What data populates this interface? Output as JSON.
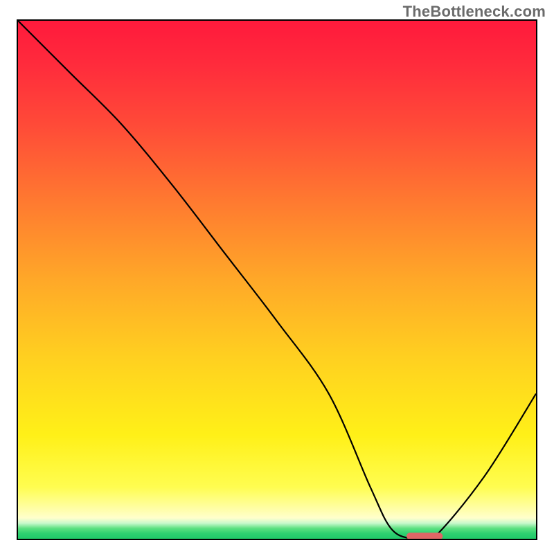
{
  "watermark": "TheBottleneck.com",
  "chart_data": {
    "type": "line",
    "title": "",
    "xlabel": "",
    "ylabel": "",
    "xlim": [
      0,
      100
    ],
    "ylim": [
      0,
      100
    ],
    "grid": false,
    "legend": false,
    "series": [
      {
        "name": "bottleneck-curve",
        "x": [
          0,
          10,
          20,
          30,
          40,
          50,
          60,
          68,
          72,
          76,
          80,
          90,
          100
        ],
        "y": [
          100,
          90,
          80,
          68,
          55,
          42,
          28,
          10,
          2,
          0,
          0,
          12,
          28
        ]
      }
    ],
    "annotations": [
      {
        "name": "optimal-marker",
        "x_range": [
          75,
          82
        ],
        "y": 0.5,
        "color": "#e06666"
      }
    ],
    "gradient_meaning": "red=high bottleneck, green=no bottleneck"
  }
}
